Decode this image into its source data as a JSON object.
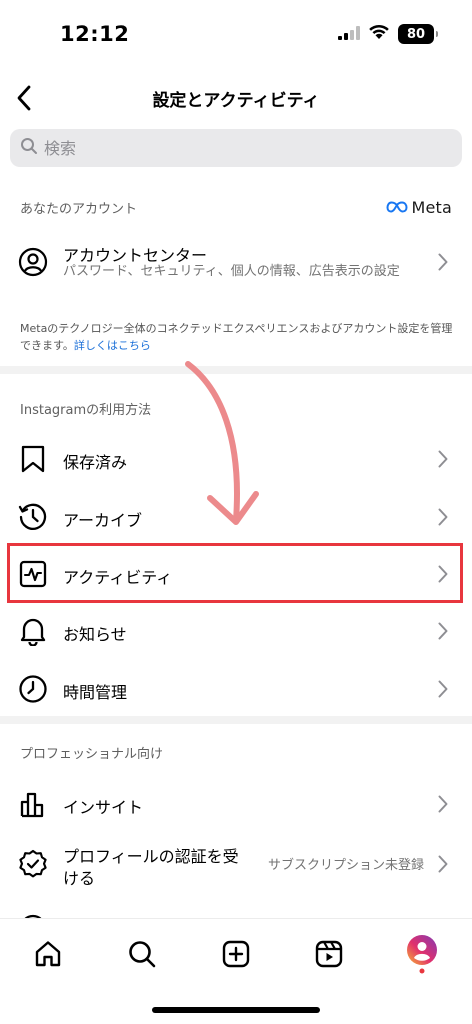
{
  "status_bar": {
    "time": "12:12",
    "battery": "80"
  },
  "nav": {
    "title": "設定とアクティビティ"
  },
  "search": {
    "placeholder": "検索"
  },
  "your_account": {
    "section_label": "あなたのアカウント",
    "meta_logo_text": "Meta",
    "account_center_label": "アカウントセンター",
    "account_center_sub": "パスワード、セキュリティ、個人の情報、広告表示の設定",
    "description": "Metaのテクノロジー全体のコネクテッドエクスペリエンスおよびアカウント設定を管理できます。",
    "learn_more": "詳しくはこちら"
  },
  "how_you_use": {
    "section_label": "Instagramの利用方法",
    "items": [
      {
        "label": "保存済み",
        "icon": "bookmark-icon"
      },
      {
        "label": "アーカイブ",
        "icon": "archive-history-icon"
      },
      {
        "label": "アクティビティ",
        "icon": "activity-chart-icon"
      },
      {
        "label": "お知らせ",
        "icon": "bell-icon"
      },
      {
        "label": "時間管理",
        "icon": "clock-icon"
      }
    ]
  },
  "professional": {
    "section_label": "プロフェッショナル向け",
    "insights_label": "インサイト",
    "verification_label": "プロフィールの認証を受ける",
    "verification_status": "サブスクリプション未登録"
  },
  "tab_bar": {
    "tabs": [
      "home-icon",
      "search-icon",
      "create-icon",
      "reels-icon",
      "profile-avatar"
    ]
  },
  "colors": {
    "highlight": "#e8363e",
    "link": "#1a6fd8",
    "arrow": "#ec8a8c"
  }
}
